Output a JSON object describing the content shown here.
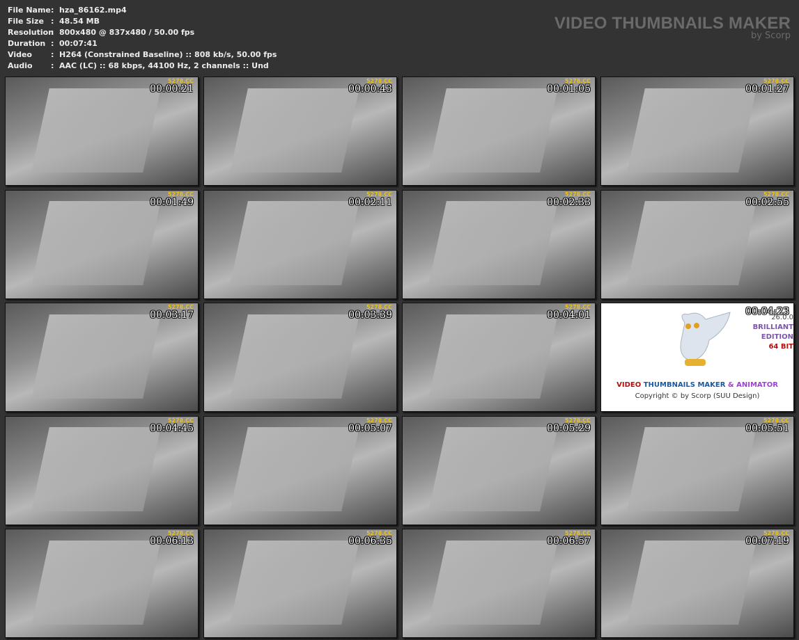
{
  "info": [
    {
      "key": "File Name",
      "value": "hza_86162.mp4"
    },
    {
      "key": "File Size",
      "value": "48.54 MB"
    },
    {
      "key": "Resolution",
      "value": "800x480 @ 837x480 / 50.00 fps"
    },
    {
      "key": "Duration",
      "value": "00:07:41"
    },
    {
      "key": "Video",
      "value": "H264 (Constrained Baseline) :: 808 kb/s, 50.00 fps"
    },
    {
      "key": "Audio",
      "value": "AAC (LC) :: 68 kbps, 44100 Hz, 2 channels :: Und"
    }
  ],
  "brand": {
    "title": "VIDEO THUMBNAILS MAKER",
    "subtitle": "by Scorp"
  },
  "watermark": "5278.CC",
  "thumbnails": [
    "00:00:21",
    "00:00:43",
    "00:01:05",
    "00:01:27",
    "00:01:49",
    "00:02:11",
    "00:02:33",
    "00:02:55",
    "00:03:17",
    "00:03:39",
    "00:04:01",
    "00:04:23",
    "00:04:45",
    "00:05:07",
    "00:05:29",
    "00:05:51",
    "00:06:13",
    "00:06:35",
    "00:06:57",
    "00:07:19"
  ],
  "splash_index": 11,
  "splash": {
    "version": "26.0.0",
    "edition1": "BRILLIANT",
    "edition2": "EDITION",
    "bits": "64 BIT",
    "w1": "VIDEO",
    "w2": "THUMBNAILS MAKER",
    "w3": "& ANIMATOR",
    "copyright": "Copyright © by Scorp (SUU Design)"
  }
}
